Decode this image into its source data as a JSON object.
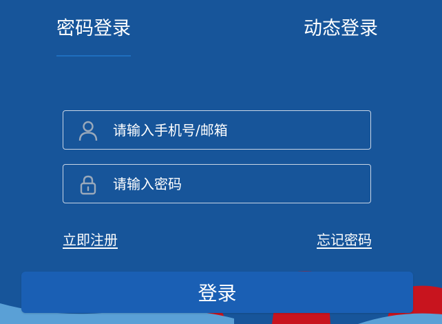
{
  "tabs": {
    "password_login": "密码登录",
    "dynamic_login": "动态登录",
    "active": "password_login"
  },
  "form": {
    "account_placeholder": "请输入手机号/邮箱",
    "password_placeholder": "请输入密码",
    "account_icon": "user-icon",
    "password_icon": "lock-icon"
  },
  "links": {
    "register": "立即注册",
    "forgot_password": "忘记密码"
  },
  "buttons": {
    "login": "登录"
  },
  "colors": {
    "background": "#17559a",
    "button": "#1a5fb4",
    "accent_red": "#c8141e",
    "accent_lightblue": "#5aa0d6",
    "text": "#ffffff"
  }
}
